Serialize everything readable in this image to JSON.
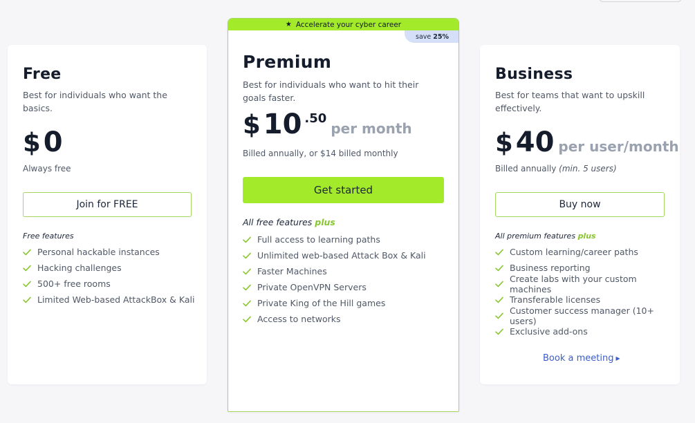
{
  "plans": {
    "free": {
      "name": "Free",
      "description": "Best for individuals who want the basics.",
      "currency": "$",
      "amount": "0",
      "billing": "Always free",
      "button_label": "Join for FREE",
      "features_heading": "Free features",
      "features": [
        "Personal hackable instances",
        "Hacking challenges",
        "500+ free rooms",
        "Limited Web-based AttackBox & Kali"
      ]
    },
    "premium": {
      "banner": "Accelerate your cyber career",
      "banner_icon": "star-icon",
      "badge_prefix": "save",
      "badge_value": "25%",
      "name": "Premium",
      "description": "Best for individuals who want to hit their goals faster.",
      "currency": "$",
      "amount": "10",
      "cents": ".50",
      "unit": "per month",
      "billing": "Billed annually, or $14 billed monthly",
      "button_label": "Get started",
      "features_heading": "All free features",
      "features_heading_plus": "plus",
      "features": [
        "Full access to learning paths",
        "Unlimited web-based Attack Box & Kali",
        "Faster Machines",
        "Private OpenVPN Servers",
        "Private King of the Hill games",
        "Access to networks"
      ]
    },
    "business": {
      "name": "Business",
      "description": "Best for teams that want to upskill effectively.",
      "currency": "$",
      "amount": "40",
      "unit": "per user/month",
      "billing": "Billed annually",
      "billing_note": "(min. 5 users)",
      "button_label": "Buy now",
      "features_heading": "All premium features",
      "features_heading_plus": "plus",
      "features": [
        "Custom learning/career paths",
        "Business reporting",
        "Create labs with your custom machines",
        "Transferable licenses",
        "Customer success manager (10+ users)",
        "Exclusive add-ons"
      ],
      "link_label": "Book a meeting"
    }
  },
  "colors": {
    "accent_green": "#a3ea2a",
    "check_green": "#88c630",
    "link_blue": "#3a5ccc",
    "badge_blue": "#d5dff7"
  }
}
